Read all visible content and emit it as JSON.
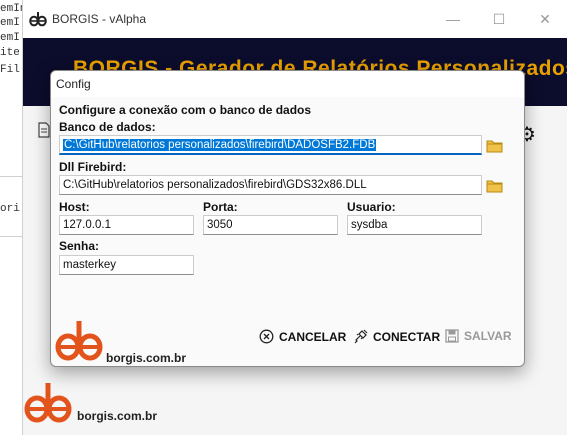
{
  "code_lines": [
    "emInfo:",
    "emI",
    "emI",
    "ite",
    "Fil",
    "ori"
  ],
  "main_window": {
    "title": "BORGIS - vAlpha",
    "banner_title": "BORGIS - Gerador de Relatórios Personalizados",
    "footer_text": "borgis.com.br",
    "window_buttons": {
      "minimize": "—",
      "maximize": "☐",
      "close": "✕"
    },
    "icons": [
      "settings-gear-icon",
      "document-icon"
    ]
  },
  "dialog": {
    "title": "Config",
    "heading": "Configure a conexão com o banco de dados",
    "database_label": "Banco de dados:",
    "database_value": "C:\\GitHub\\relatorios personalizados\\firebird\\DADOSFB2.FDB",
    "dll_label": "Dll Firebird:",
    "dll_value": "C:\\GitHub\\relatorios personalizados\\firebird\\GDS32x86.DLL",
    "host_label": "Host:",
    "host_value": "127.0.0.1",
    "port_label": "Porta:",
    "port_value": "3050",
    "user_label": "Usuario:",
    "user_value": "sysdba",
    "password_label": "Senha:",
    "password_value": "masterkey",
    "cancel_label": "CANCELAR",
    "connect_label": "CONECTAR",
    "save_label": "SALVAR",
    "footer_text": "borgis.com.br"
  },
  "colors": {
    "accent": "#0078d7",
    "banner_bg": "#0c0c2c",
    "banner_text": "#e8a000",
    "logo": "#e2541b"
  }
}
